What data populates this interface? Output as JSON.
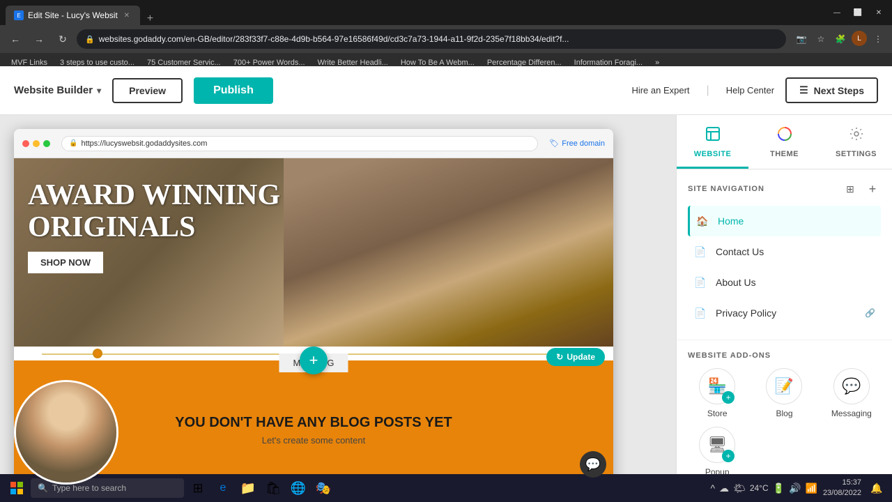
{
  "browser": {
    "tabs": [
      {
        "label": "Edit Site - Lucy's Websit",
        "active": true,
        "favicon": "E"
      },
      {
        "label": "+",
        "active": false
      }
    ],
    "address": "websites.godaddy.com/en-GB/editor/283f33f7-c88e-4d9b-b564-97e16586f49d/cd3c7a73-1944-a11-9f2d-235e7f18bb34/edit?f...",
    "bookmarks": [
      "MVF Links",
      "3 steps to use custo...",
      "75 Customer Servic...",
      "700+ Power Words...",
      "Write Better Headli...",
      "How To Be A Webm...",
      "Percentage Differen...",
      "Information Foragi..."
    ]
  },
  "appbar": {
    "builder_label": "Website Builder",
    "preview_label": "Preview",
    "publish_label": "Publish",
    "hire_expert_label": "Hire an Expert",
    "help_center_label": "Help Center",
    "next_steps_label": "Next Steps"
  },
  "preview": {
    "url": "https://lucyswebsit.godaddysites.com",
    "free_domain_label": "Free domain",
    "hero_title_line1": "AWARD WINNING",
    "hero_title_line2": "ORIGINALS",
    "shop_now_label": "SHOP NOW",
    "update_label": "Update",
    "my_blog_label": "MY BLOG",
    "blog_empty_title": "YOU DON'T HAVE ANY BLOG POSTS YET",
    "blog_empty_subtitle": "Let's create some content"
  },
  "right_panel": {
    "tabs": [
      {
        "id": "website",
        "label": "WEBSITE",
        "active": true
      },
      {
        "id": "theme",
        "label": "THEME",
        "active": false
      },
      {
        "id": "settings",
        "label": "SETTINGS",
        "active": false
      }
    ],
    "site_navigation": {
      "title": "SITE NAVIGATION",
      "items": [
        {
          "id": "home",
          "label": "Home",
          "active": true,
          "icon": "🏠"
        },
        {
          "id": "contact",
          "label": "Contact Us",
          "active": false,
          "icon": "📄"
        },
        {
          "id": "about",
          "label": "About Us",
          "active": false,
          "icon": "📄"
        },
        {
          "id": "privacy",
          "label": "Privacy Policy",
          "active": false,
          "icon": "📄",
          "has_lock": true
        }
      ]
    },
    "addons": {
      "title": "WEBSITE ADD-ONS",
      "items": [
        {
          "id": "store",
          "label": "Store",
          "icon": "🏪",
          "has_plus": true
        },
        {
          "id": "blog",
          "label": "Blog",
          "icon": "📝",
          "has_plus": false
        },
        {
          "id": "messaging",
          "label": "Messaging",
          "icon": "💬",
          "has_plus": false
        },
        {
          "id": "popup",
          "label": "Popup",
          "icon": "🖥",
          "has_plus": true
        }
      ]
    }
  },
  "taskbar": {
    "search_placeholder": "Type here to search",
    "time": "15:37",
    "date": "23/08/2022",
    "weather": "24°C"
  }
}
